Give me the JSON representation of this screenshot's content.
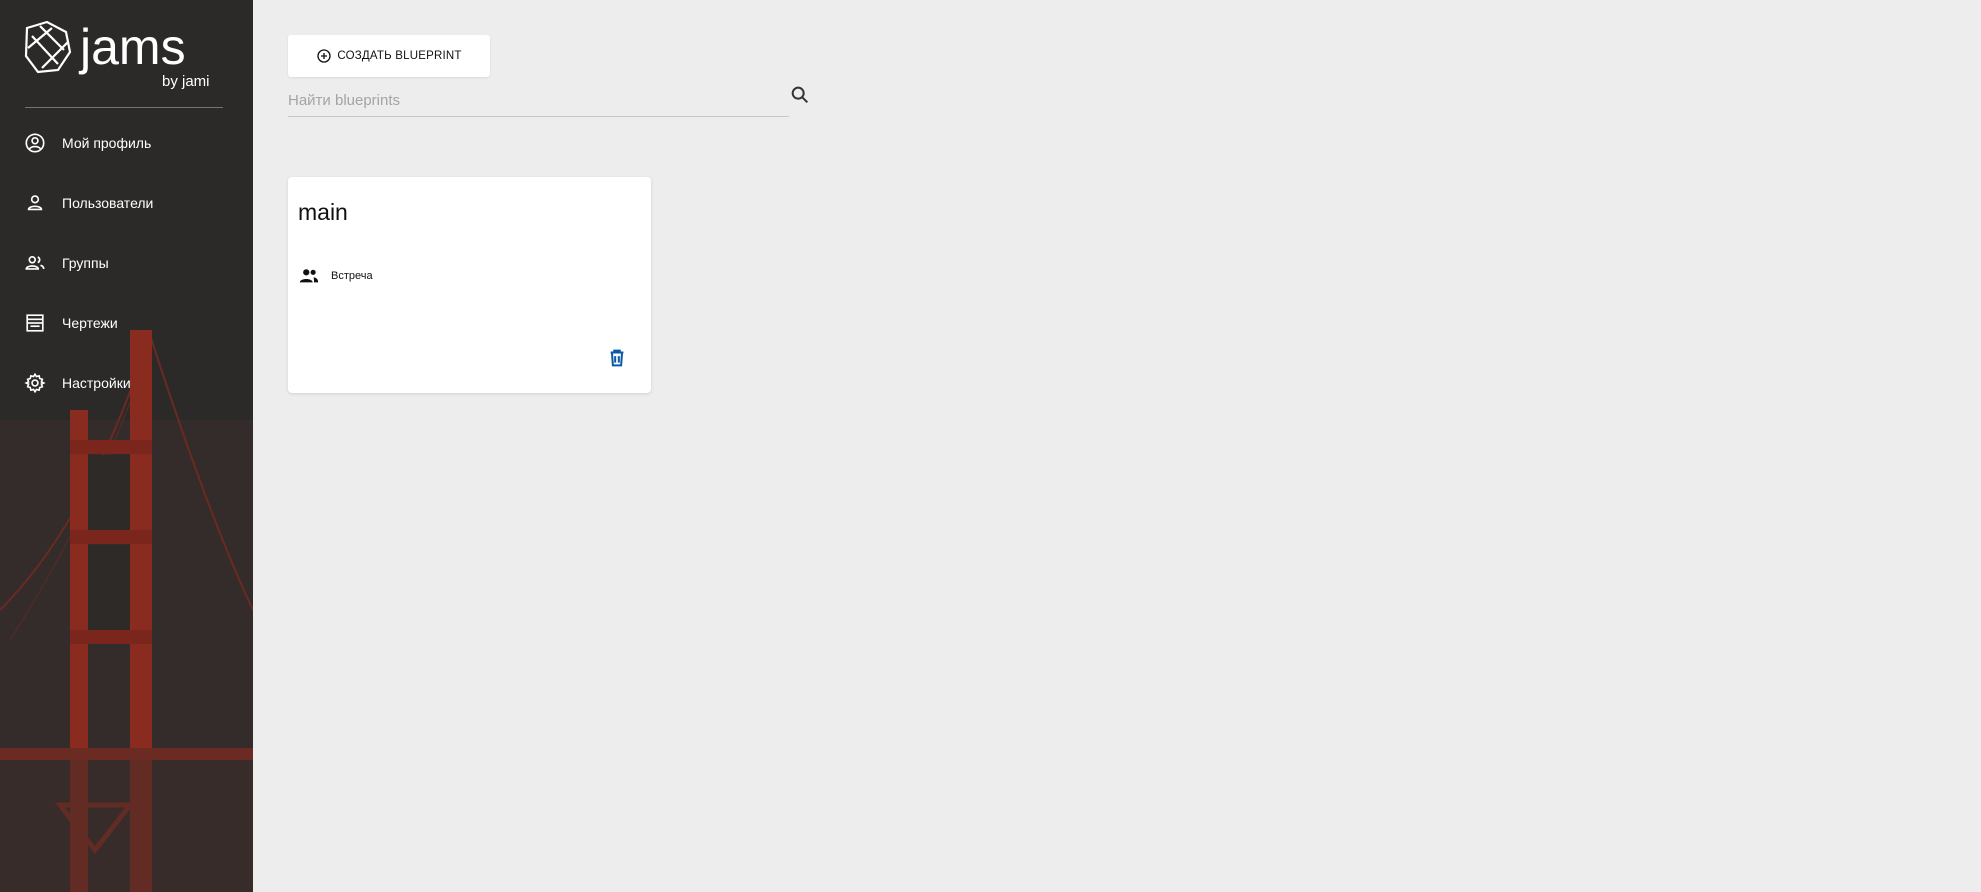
{
  "brand": {
    "logo_text": "jams",
    "logo_subtext": "by jami"
  },
  "sidebar": {
    "items": [
      {
        "label": "Мой профиль",
        "icon": "account-circle-icon"
      },
      {
        "label": "Пользователи",
        "icon": "person-icon"
      },
      {
        "label": "Группы",
        "icon": "people-icon"
      },
      {
        "label": "Чертежи",
        "icon": "blueprint-icon"
      },
      {
        "label": "Настройки",
        "icon": "gear-icon"
      }
    ]
  },
  "toolbar": {
    "create_label": "СОЗДАТЬ BLUEPRINT",
    "create_icon": "add-circle-icon"
  },
  "search": {
    "placeholder": "Найти blueprints",
    "value": "",
    "icon": "search-icon"
  },
  "blueprints": [
    {
      "name": "main",
      "mode_label": "Встреча",
      "mode_icon": "people-icon",
      "delete_icon": "trash-icon"
    }
  ],
  "colors": {
    "sidebar_bg": "#2b2a27",
    "main_bg": "#ededed",
    "card_bg": "#ffffff",
    "delete_icon": "#0a5aa8"
  }
}
